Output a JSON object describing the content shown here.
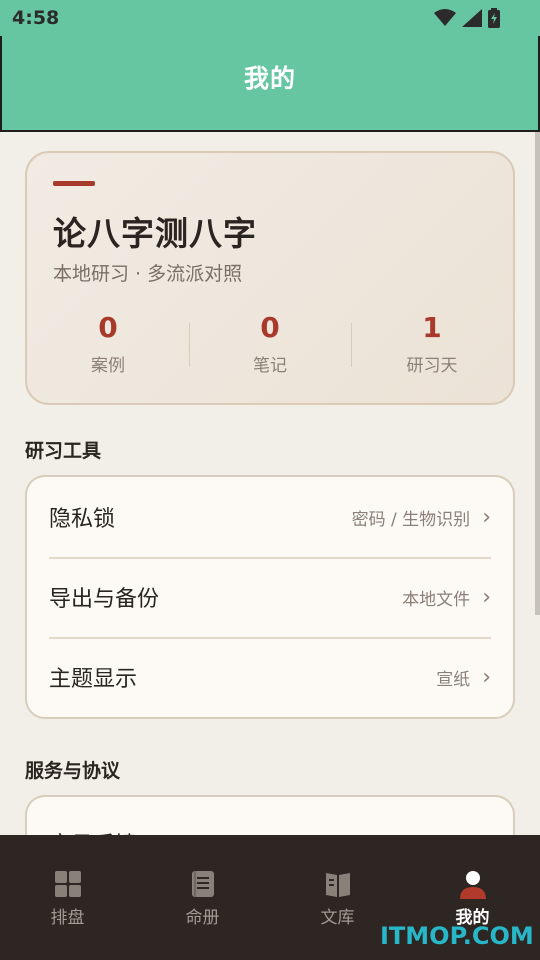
{
  "status_bar": {
    "time": "4:58"
  },
  "header": {
    "title": "我的"
  },
  "hero": {
    "title": "论八字测八字",
    "subtitle": "本地研习 · 多流派对照",
    "stats": [
      {
        "value": "0",
        "label": "案例"
      },
      {
        "value": "0",
        "label": "笔记"
      },
      {
        "value": "1",
        "label": "研习天"
      }
    ]
  },
  "tools_section": {
    "title": "研习工具",
    "items": [
      {
        "label": "隐私锁",
        "value": "密码 / 生物识别",
        "chevron": "›"
      },
      {
        "label": "导出与备份",
        "value": "本地文件",
        "chevron": "›"
      },
      {
        "label": "主题显示",
        "value": "宣纸",
        "chevron": "›"
      }
    ]
  },
  "service_section": {
    "title": "服务与协议",
    "items": [
      {
        "label": "意见反馈"
      }
    ]
  },
  "tab_bar": {
    "tabs": [
      {
        "label": "排盘",
        "icon": "grid-icon"
      },
      {
        "label": "命册",
        "icon": "book-icon"
      },
      {
        "label": "文库",
        "icon": "library-icon"
      },
      {
        "label": "我的",
        "icon": "person-icon",
        "active": true
      }
    ]
  },
  "watermark": "ITMOP.COM",
  "colors": {
    "header": "#66c6a1",
    "accent": "#a83a2b",
    "tab_bar": "#2d2622",
    "background": "#f2eee8"
  }
}
